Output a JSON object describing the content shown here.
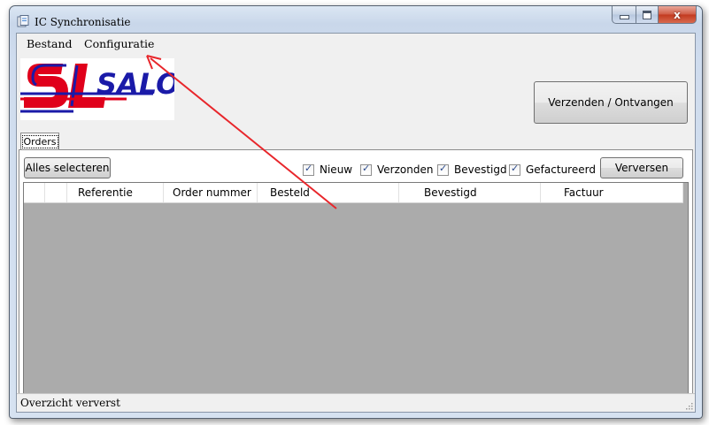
{
  "window": {
    "title": "IC Synchronisatie"
  },
  "menu": {
    "items": [
      "Bestand",
      "Configuratie"
    ]
  },
  "logo": {
    "text": "SALO"
  },
  "toolbar": {
    "send_receive_label": "Verzenden / Ontvangen"
  },
  "tabs": [
    {
      "label": "Orders"
    }
  ],
  "orders": {
    "select_all_label": "Alles selecteren",
    "filters": [
      {
        "label": "Nieuw",
        "checked": true
      },
      {
        "label": "Verzonden",
        "checked": true
      },
      {
        "label": "Bevestigd",
        "checked": true
      },
      {
        "label": "Gefactureerd",
        "checked": true
      }
    ],
    "refresh_label": "Verversen",
    "columns": [
      "Referentie",
      "Order nummer",
      "Besteld",
      "Bevestigd",
      "Factuur"
    ]
  },
  "status": {
    "text": "Overzicht ververst"
  },
  "colors": {
    "grid_bg": "#ababab",
    "logo_red": "#e0001b",
    "logo_blue": "#1a1aa8",
    "arrow": "#e8262b"
  }
}
